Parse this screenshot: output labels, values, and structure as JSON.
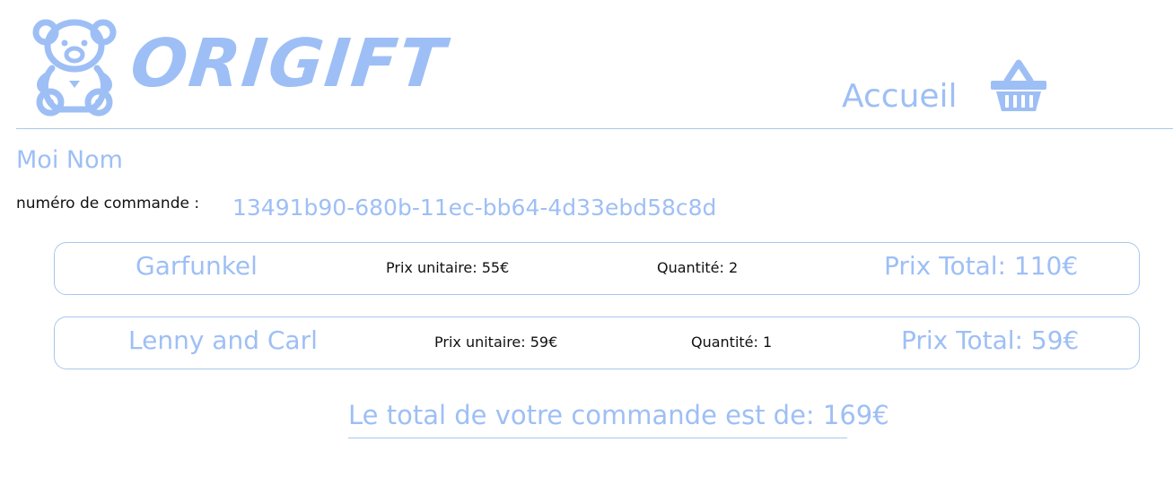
{
  "header": {
    "brand": "ORIGIFT",
    "nav_home": "Accueil",
    "icons": {
      "logo": "teddy-bear-icon",
      "cart": "basket-icon"
    }
  },
  "customer": {
    "name": "Moi Nom"
  },
  "order": {
    "number_label": "numéro de commande :",
    "number": "13491b90-680b-11ec-bb64-4d33ebd58c8d",
    "lines": [
      {
        "product": "Garfunkel",
        "unit_price": "Prix unitaire: 55€",
        "quantity": "Quantité: 2",
        "total": "Prix Total: 110€"
      },
      {
        "product": "Lenny and Carl",
        "unit_price": "Prix unitaire: 59€",
        "quantity": "Quantité: 1",
        "total": "Prix Total: 59€"
      }
    ],
    "grand_total": "Le total de votre commande est de: 169€"
  },
  "colors": {
    "accent": "#9ebff5",
    "border": "#a9c7ee",
    "text": "#111111"
  }
}
